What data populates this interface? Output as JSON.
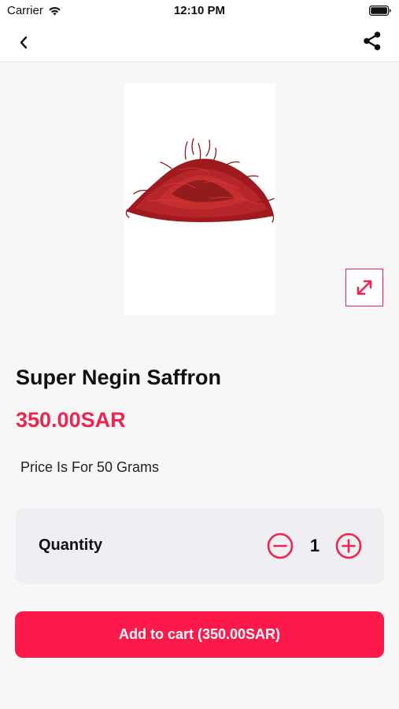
{
  "status_bar": {
    "carrier": "Carrier",
    "time": "12:10 PM"
  },
  "nav": {
    "back_icon": "chevron-left-icon",
    "share_icon": "share-icon"
  },
  "product": {
    "image_alt": "saffron",
    "title": "Super Negin Saffron",
    "price": "350.00SAR",
    "description": "Price Is For 50 Grams"
  },
  "quantity": {
    "label": "Quantity",
    "value": "1"
  },
  "cart": {
    "button_label": "Add to cart (350.00SAR)"
  },
  "colors": {
    "accent": "#f0254f",
    "button": "#fd1a4b",
    "background": "#f7f7f8",
    "card": "#efeef2"
  }
}
